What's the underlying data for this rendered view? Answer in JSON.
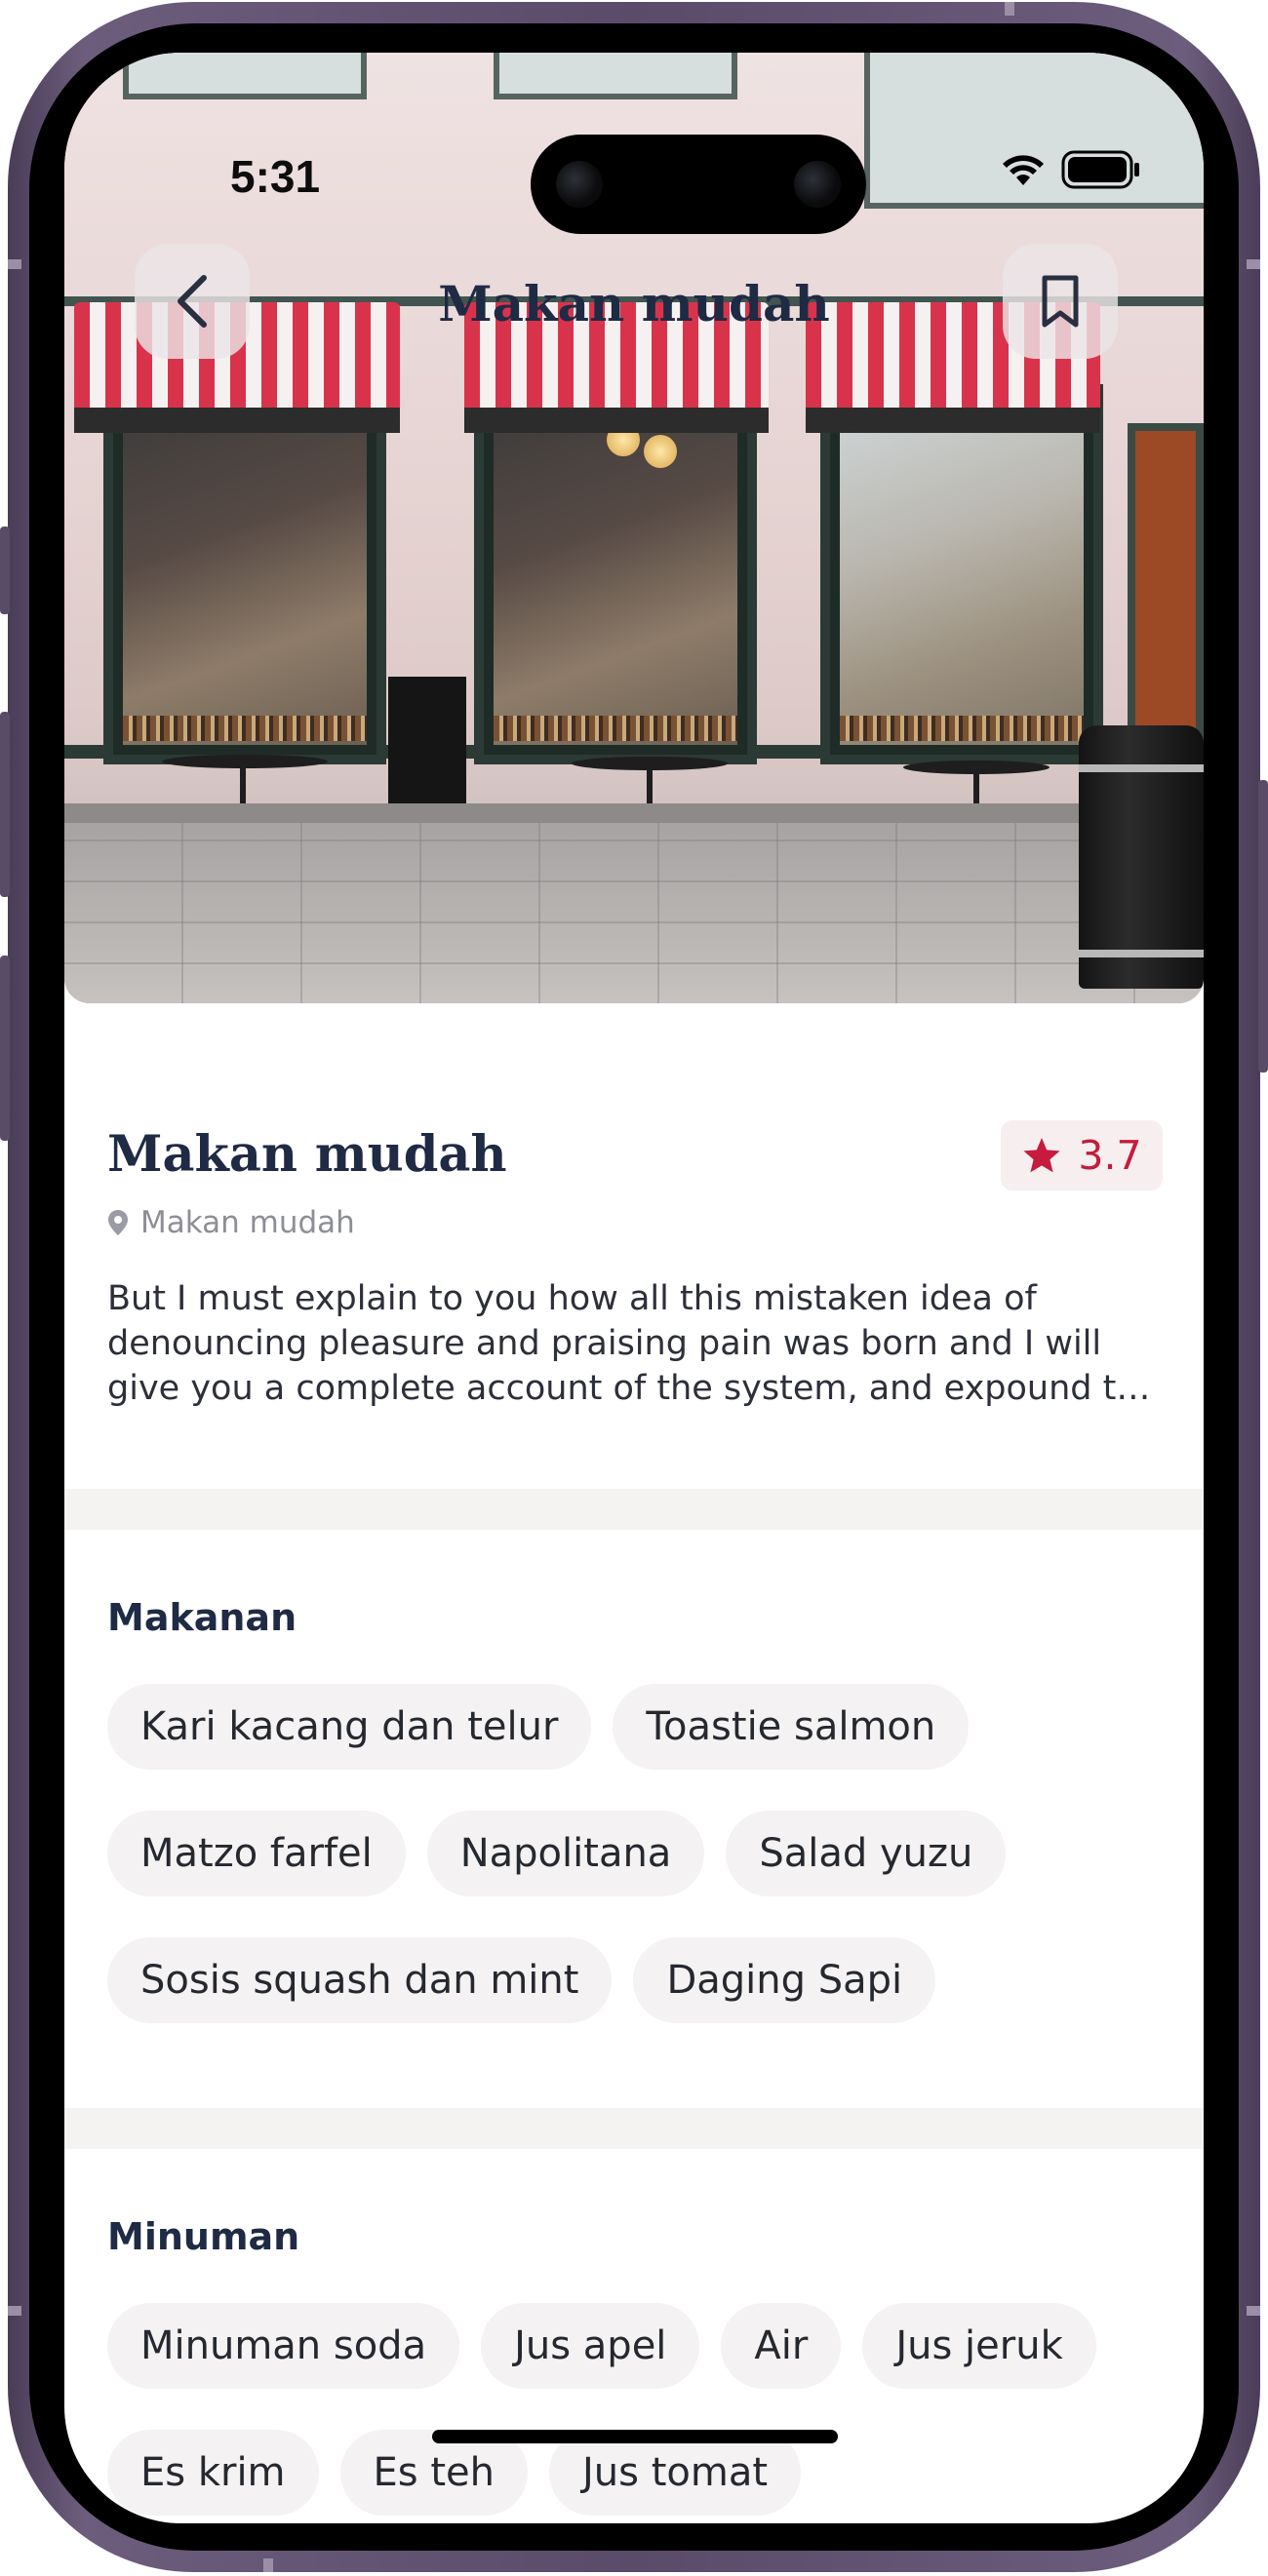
{
  "status_bar": {
    "time": "5:31",
    "icons": [
      "wifi-icon",
      "battery-icon"
    ]
  },
  "header": {
    "title": "Makan mudah",
    "back_icon": "chevron-left-icon",
    "bookmark_icon": "bookmark-icon"
  },
  "place": {
    "name": "Makan mudah",
    "location": "Makan mudah",
    "location_icon": "map-pin-icon",
    "rating": "3.7",
    "rating_icon": "star-icon",
    "description": "But I must explain to you how all this mistaken idea of denouncing pleasure and praising pain was born and I will give you a complete account of the system, and expound the actual teachings of the great explorer of the truth"
  },
  "sections": {
    "food": {
      "heading": "Makanan",
      "items": [
        "Kari kacang dan telur",
        "Toastie salmon",
        "Matzo farfel",
        "Napolitana",
        "Salad yuzu",
        "Sosis squash dan mint",
        "Daging Sapi"
      ]
    },
    "drinks": {
      "heading": "Minuman",
      "items": [
        "Minuman soda",
        "Jus apel",
        "Air",
        "Jus jeruk",
        "Es krim",
        "Es teh",
        "Jus tomat"
      ]
    }
  },
  "colors": {
    "title": "#1f2a44",
    "accent_red": "#c61b3c",
    "rating_bg": "#f7eef0",
    "chip_bg": "#f4f2f2",
    "frame": "#5a4b69"
  }
}
